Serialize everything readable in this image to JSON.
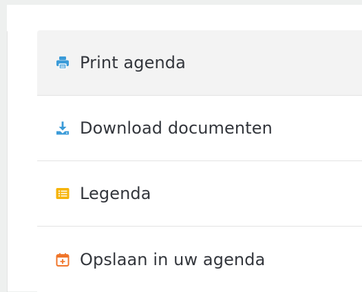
{
  "menu": {
    "items": [
      {
        "label": "Print agenda",
        "icon": "print-icon",
        "icon_color": "#3b9bd8",
        "active": true
      },
      {
        "label": "Download documenten",
        "icon": "download-icon",
        "icon_color": "#3b9bd8",
        "active": false
      },
      {
        "label": "Legenda",
        "icon": "list-icon",
        "icon_color": "#f6b40a",
        "active": false
      },
      {
        "label": "Opslaan in uw agenda",
        "icon": "calendar-add-icon",
        "icon_color": "#f0752a",
        "active": false
      }
    ]
  }
}
